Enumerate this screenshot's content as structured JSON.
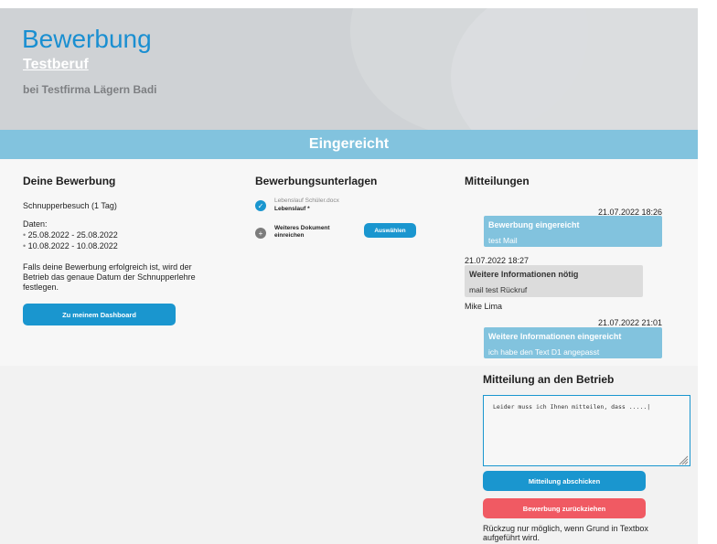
{
  "header": {
    "title": "Bewerbung",
    "subtitle": "Testberuf",
    "company": "bei Testfirma Lägern Badi"
  },
  "status": "Eingereicht",
  "application": {
    "heading": "Deine Bewerbung",
    "type": "Schnupperbesuch (1 Tag)",
    "dates_label": "Daten:",
    "dates": [
      "25.08.2022 - 25.08.2022",
      "10.08.2022 - 10.08.2022"
    ],
    "info_lines": [
      "Falls deine Bewerbung erfolgreich ist, wird der",
      "Betrieb das genaue Datum der Schnupperlehre",
      "festlegen."
    ],
    "dashboard_button": "Zu meinem Dashboard"
  },
  "documents": {
    "heading": "Bewerbungsunterlagen",
    "items": [
      {
        "filename": "Lebenslauf Schüler.docx",
        "label": "Lebenslauf *"
      },
      {
        "label_line1": "Weiteres Dokument",
        "label_line2": "einreichen",
        "button": "Auswählen"
      }
    ]
  },
  "messages": {
    "heading": "Mitteilungen",
    "items": [
      {
        "timestamp": "21.07.2022 18:26",
        "title": "Bewerbung eingereicht",
        "text": "test Mail",
        "side": "right"
      },
      {
        "timestamp": "21.07.2022 18:27",
        "title": "Weitere Informationen nötig",
        "text": "mail test Rückruf",
        "author": "Mike Lima",
        "side": "left"
      },
      {
        "timestamp": "21.07.2022 21:01",
        "title": "Weitere Informationen eingereicht",
        "text": "ich habe den Text D1 angepasst",
        "side": "right"
      }
    ]
  },
  "compose": {
    "heading": "Mitteilung an den Betrieb",
    "value": "Leider muss ich Ihnen mitteilen, dass .....|",
    "send_button": "Mitteilung abschicken",
    "withdraw_button": "Bewerbung zurückziehen",
    "note_lines": [
      "Rückzug nur möglich, wenn Grund in Textbox",
      "aufgeführt wird."
    ]
  },
  "colors": {
    "accent": "#1a96cf",
    "status_bar": "#82c3de",
    "danger": "#f05a63"
  }
}
